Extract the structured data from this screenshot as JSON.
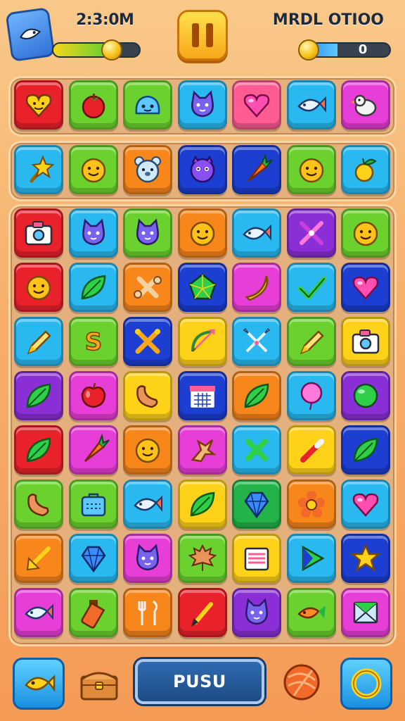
{
  "header": {
    "timer_text": "2:3:0M",
    "score_label": "MRDL OTIOO",
    "score_value": "0",
    "timer_bar_fill": 0.58,
    "score_bar_fill": 0.4
  },
  "colors": {
    "red": "#e8212b",
    "lime": "#6bd12e",
    "cyan": "#29b9f0",
    "pink": "#ff5c93",
    "purple": "#8a2fd6",
    "orange": "#f7861b",
    "yellow": "#ffd21a",
    "blue": "#1d3fd1",
    "magenta": "#e63ed6",
    "green": "#23b34a"
  },
  "grid": [
    [
      {
        "color": "red",
        "icon": "heart-face-icon"
      },
      {
        "color": "lime",
        "icon": "tomato-icon"
      },
      {
        "color": "lime",
        "icon": "blob-face-icon"
      },
      {
        "color": "cyan",
        "icon": "cat-face-icon"
      },
      {
        "color": "pink",
        "icon": "heart-icon"
      },
      {
        "color": "cyan",
        "icon": "fish-icon"
      },
      {
        "color": "magenta",
        "icon": "bird-icon"
      }
    ],
    [
      {
        "color": "cyan",
        "icon": "star-wand-icon"
      },
      {
        "color": "lime",
        "icon": "smiley-icon"
      },
      {
        "color": "orange",
        "icon": "bear-face-icon"
      },
      {
        "color": "blue",
        "icon": "monster-face-icon"
      },
      {
        "color": "blue",
        "icon": "carrot-icon"
      },
      {
        "color": "lime",
        "icon": "smiley-icon"
      },
      {
        "color": "cyan",
        "icon": "fruit-icon"
      }
    ],
    [
      {
        "color": "red",
        "icon": "camera-icon"
      },
      {
        "color": "cyan",
        "icon": "cat-face-icon"
      },
      {
        "color": "lime",
        "icon": "cat-face-icon"
      },
      {
        "color": "orange",
        "icon": "smiley-icon"
      },
      {
        "color": "cyan",
        "icon": "fish-icon"
      },
      {
        "color": "purple",
        "icon": "cross-tool-icon"
      },
      {
        "color": "lime",
        "icon": "smiley-icon"
      }
    ],
    [
      {
        "color": "red",
        "icon": "smiley-icon"
      },
      {
        "color": "cyan",
        "icon": "leaf-icon"
      },
      {
        "color": "orange",
        "icon": "bone-icon"
      },
      {
        "color": "blue",
        "icon": "pentagon-icon"
      },
      {
        "color": "magenta",
        "icon": "banana-icon"
      },
      {
        "color": "cyan",
        "icon": "check-icon"
      },
      {
        "color": "blue",
        "icon": "heart-icon"
      }
    ],
    [
      {
        "color": "cyan",
        "icon": "pencil-icon"
      },
      {
        "color": "lime",
        "icon": "letter-s-icon"
      },
      {
        "color": "blue",
        "icon": "crossed-tools-icon"
      },
      {
        "color": "yellow",
        "icon": "bow-icon"
      },
      {
        "color": "cyan",
        "icon": "crossed-swords-icon"
      },
      {
        "color": "lime",
        "icon": "pencil-icon"
      },
      {
        "color": "yellow",
        "icon": "camera-icon"
      }
    ],
    [
      {
        "color": "purple",
        "icon": "leaf-icon"
      },
      {
        "color": "magenta",
        "icon": "apple-icon"
      },
      {
        "color": "yellow",
        "icon": "sausage-icon"
      },
      {
        "color": "blue",
        "icon": "calendar-icon"
      },
      {
        "color": "orange",
        "icon": "leaf-icon"
      },
      {
        "color": "cyan",
        "icon": "balloon-icon"
      },
      {
        "color": "purple",
        "icon": "ball-icon"
      }
    ],
    [
      {
        "color": "red",
        "icon": "leaf-icon"
      },
      {
        "color": "magenta",
        "icon": "carrot-icon"
      },
      {
        "color": "orange",
        "icon": "smiley-icon"
      },
      {
        "color": "magenta",
        "icon": "ginger-icon"
      },
      {
        "color": "cyan",
        "icon": "cross-icon"
      },
      {
        "color": "yellow",
        "icon": "marker-icon"
      },
      {
        "color": "blue",
        "icon": "leaf-icon"
      }
    ],
    [
      {
        "color": "lime",
        "icon": "sausage-icon"
      },
      {
        "color": "lime",
        "icon": "bag-icon"
      },
      {
        "color": "cyan",
        "icon": "fish-icon"
      },
      {
        "color": "yellow",
        "icon": "leaf-icon"
      },
      {
        "color": "green",
        "icon": "gem-icon"
      },
      {
        "color": "orange",
        "icon": "flower-icon"
      },
      {
        "color": "cyan",
        "icon": "heart-icon"
      }
    ],
    [
      {
        "color": "orange",
        "icon": "arrow-icon"
      },
      {
        "color": "cyan",
        "icon": "gem-icon"
      },
      {
        "color": "magenta",
        "icon": "cat-face-icon"
      },
      {
        "color": "lime",
        "icon": "maple-leaf-icon"
      },
      {
        "color": "yellow",
        "icon": "box-icon"
      },
      {
        "color": "cyan",
        "icon": "play-icon"
      },
      {
        "color": "blue",
        "icon": "star-icon"
      }
    ],
    [
      {
        "color": "magenta",
        "icon": "fish-icon"
      },
      {
        "color": "lime",
        "icon": "bottle-icon"
      },
      {
        "color": "orange",
        "icon": "fork-icon"
      },
      {
        "color": "red",
        "icon": "brush-icon"
      },
      {
        "color": "purple",
        "icon": "cat-face-icon"
      },
      {
        "color": "lime",
        "icon": "carrot-fish-icon"
      },
      {
        "color": "magenta",
        "icon": "envelope-icon"
      }
    ]
  ],
  "bottom": {
    "push_label": "PUSU",
    "left_icon": "fish-icon",
    "chest_icon": "chest-icon",
    "yarn_icon": "yarn-icon",
    "ring_icon": "ring-icon"
  }
}
